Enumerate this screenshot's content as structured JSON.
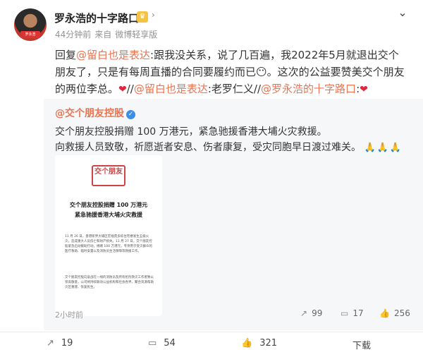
{
  "header": {
    "user_name": "罗永浩的十字路口",
    "avatar_tag": "罗永浩",
    "badge_icon": "crown-badge-icon",
    "time_ago": "44分钟前",
    "source_prefix": "来自",
    "source": "微博轻享版"
  },
  "post": {
    "reply_prefix": "回复",
    "mention1": "@留白也是表达",
    "text1": ":跟我没关系，说了几百遍，我2022年5月就退出交个朋友了，只是有每周直播的合同要履约而已",
    "emoji_text": "😶",
    "text2": "。这次的公益要赞美交个朋友的两位李总。",
    "heart": "❤",
    "sep1": "//",
    "mention2": "@留白也是表达",
    "text3": ":老罗仁义//",
    "mention3": "@罗永浩的十字路口",
    "text4": ":"
  },
  "repost": {
    "author": "@交个朋友控股",
    "line1": "交个朋友控股捐赠 100 万港元，紧急驰援香港大埔火灾救援。",
    "line2": "向救援人员致敬，祈愿逝者安息、伤者康复，受灾同胞早日渡过难关。",
    "pray": "🙏🙏🙏",
    "time": "2小时前",
    "share_count": "99",
    "comment_count": "17",
    "like_count": "256"
  },
  "announcement": {
    "seal_text": "交个朋友",
    "title1": "交个朋友控股捐赠 100 万港元",
    "title2": "紧急驰援香港大埔火灾救援",
    "para1": "11 月 26 日，香港新界大埔区宏福苑多栋住宅楼发生五级火灾，造成重大人员伤亡和财产损失。11 月 27 日，交个朋友控股紧急启动援助行动，捐赠 100 万港元，专项用于受灾群众的医疗救助、临时安置以及消防员生活保障等救援工作。",
    "para2": "交个朋友控股向奋战在一线的消防员及所有抢险救灾工作者致以崇高敬意，公司将持续联动公益机构和社会各界，聚合资源帮助灾区重建、恢复民生。"
  },
  "actions": {
    "share_count": "19",
    "comment_count": "54",
    "like_count": "321",
    "download_label": "下载"
  }
}
